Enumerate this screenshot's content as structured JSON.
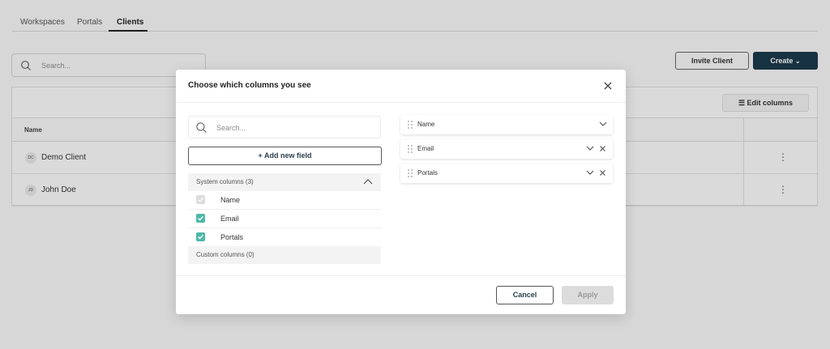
{
  "nav": {
    "tabs": [
      {
        "label": "Workspaces",
        "active": false
      },
      {
        "label": "Portals",
        "active": false
      },
      {
        "label": "Clients",
        "active": true
      }
    ]
  },
  "page": {
    "search_placeholder": "Search...",
    "invite_label": "Invite Client",
    "create_label": "Create",
    "edit_columns_label": "Edit columns",
    "table": {
      "header_name": "Name",
      "rows": [
        {
          "initials": "DC",
          "name": "Demo Client"
        },
        {
          "initials": "JD",
          "name": "John Doe"
        }
      ]
    }
  },
  "modal": {
    "title": "Choose which columns you see",
    "search_placeholder": "Search...",
    "add_field_label": "+ Add new field",
    "system_section_label": "System columns (3)",
    "system_columns": [
      {
        "label": "Name",
        "checked": true,
        "disabled": true
      },
      {
        "label": "Email",
        "checked": true,
        "disabled": false
      },
      {
        "label": "Portals",
        "checked": true,
        "disabled": false
      }
    ],
    "custom_section_label": "Custom columns (0)",
    "selected_columns": [
      {
        "label": "Name",
        "removable": false
      },
      {
        "label": "Email",
        "removable": true
      },
      {
        "label": "Portals",
        "removable": true
      }
    ],
    "cancel_label": "Cancel",
    "apply_label": "Apply"
  },
  "colors": {
    "primary_dark": "#1b3a4b",
    "checkbox_teal": "#4fb8a7",
    "disabled_gray": "#dcdcdc"
  }
}
